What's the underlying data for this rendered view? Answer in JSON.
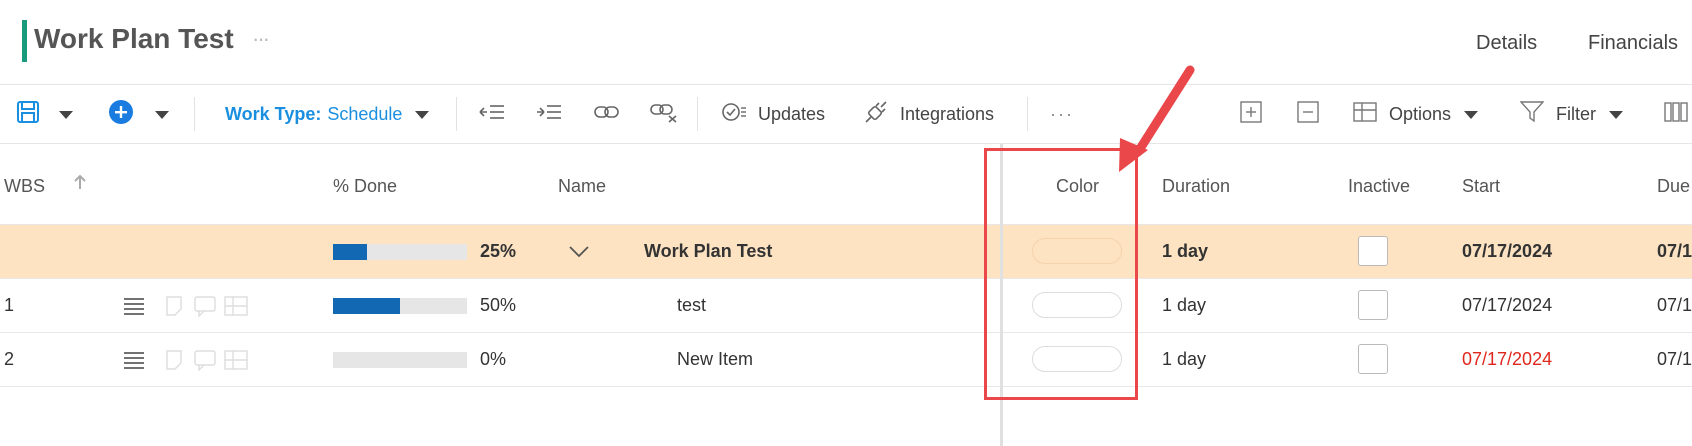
{
  "header": {
    "title": "Work Plan Test",
    "more": "···",
    "tabs": [
      "Details",
      "Financials"
    ]
  },
  "toolbar": {
    "work_type_label": "Work Type:",
    "work_type_value": "Schedule",
    "updates": "Updates",
    "integrations": "Integrations",
    "more": "···",
    "options": "Options",
    "filter": "Filter"
  },
  "columns": {
    "wbs": "WBS",
    "done": "% Done",
    "name": "Name",
    "color": "Color",
    "duration": "Duration",
    "inactive": "Inactive",
    "start": "Start",
    "due": "Due"
  },
  "rows": [
    {
      "wbs": "",
      "progress": 0.25,
      "percent": "25%",
      "name": "Work Plan Test",
      "duration": "1 day",
      "start": "07/17/2024",
      "due": "07/1",
      "group": true
    },
    {
      "wbs": "1",
      "progress": 0.5,
      "percent": "50%",
      "name": "test",
      "duration": "1 day",
      "start": "07/17/2024",
      "due": "07/1",
      "group": false
    },
    {
      "wbs": "2",
      "progress": 0.0,
      "percent": "0%",
      "name": "New Item",
      "duration": "1 day",
      "start": "07/17/2024",
      "due": "07/1",
      "group": false
    }
  ],
  "colors": {
    "accent": "#1a9a7c",
    "link_blue": "#1a8fe0",
    "progress_fill": "#1268b3",
    "group_row_bg": "#fde3c2",
    "overdue_date": "#e0271d",
    "annotation_red": "#e9474a"
  },
  "annotation": {
    "arrow": "red-arrow-pointing-to-color-column",
    "box": "red-highlight-box"
  }
}
